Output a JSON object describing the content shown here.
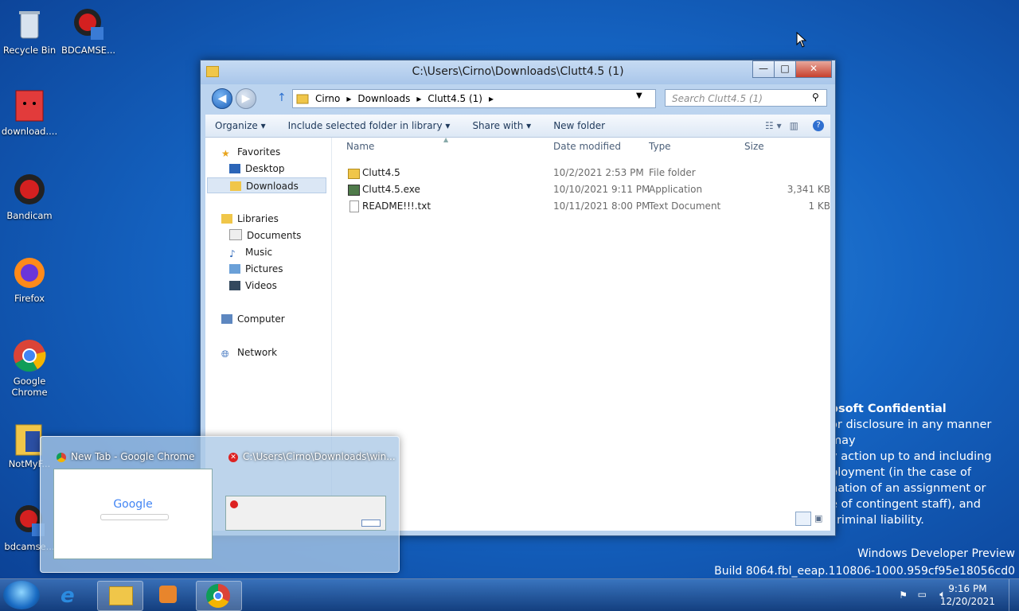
{
  "desktop": {
    "icons": [
      {
        "label": "Recycle Bin"
      },
      {
        "label": "BDCAMSE..."
      },
      {
        "label": "download...."
      },
      {
        "label": "Bandicam"
      },
      {
        "label": "Firefox"
      },
      {
        "label": "Google Chrome"
      },
      {
        "label": "NotMyF..."
      },
      {
        "label": "bdcamse..."
      }
    ],
    "watermark_lines": [
      "osoft Confidential",
      "or disclosure in any manner may",
      "y action up to and including",
      "ployment (in the case of",
      "nation of an assignment or",
      "e of contingent staff), and",
      "criminal liability."
    ],
    "build_lines": [
      "Windows Developer Preview",
      "Build 8064.fbl_eeap.110806-1000.959cf95e18056cd0"
    ]
  },
  "window": {
    "title": "C:\\Users\\Cirno\\Downloads\\Clutt4.5 (1)",
    "buttons": {
      "minimize": "—",
      "maximize": "□",
      "close": "✕"
    },
    "breadcrumb": [
      "Cirno",
      "Downloads",
      "Clutt4.5 (1)"
    ],
    "search_placeholder": "Search Clutt4.5 (1)",
    "toolbar": {
      "organize": "Organize",
      "include": "Include selected folder in library",
      "share": "Share with",
      "new_folder": "New folder"
    },
    "nav": {
      "favorites": "Favorites",
      "desktop": "Desktop",
      "downloads": "Downloads",
      "libraries": "Libraries",
      "documents": "Documents",
      "music": "Music",
      "pictures": "Pictures",
      "videos": "Videos",
      "computer": "Computer",
      "network": "Network"
    },
    "columns": {
      "name": "Name",
      "date": "Date modified",
      "type": "Type",
      "size": "Size"
    },
    "files": [
      {
        "name": "Clutt4.5",
        "date": "10/2/2021 2:53 PM",
        "type": "File folder",
        "size": ""
      },
      {
        "name": "Clutt4.5.exe",
        "date": "10/10/2021 9:11 PM",
        "type": "Application",
        "size": "3,341 KB"
      },
      {
        "name": "README!!!.txt",
        "date": "10/11/2021 8:00 PM",
        "type": "Text Document",
        "size": "1 KB"
      }
    ]
  },
  "peek": {
    "chrome_title": "New Tab - Google Chrome",
    "chrome_logo": "Google",
    "explorer_title": "C:\\Users\\Cirno\\Downloads\\win..."
  },
  "taskbar": {
    "time": "9:16 PM",
    "date": "12/20/2021"
  }
}
